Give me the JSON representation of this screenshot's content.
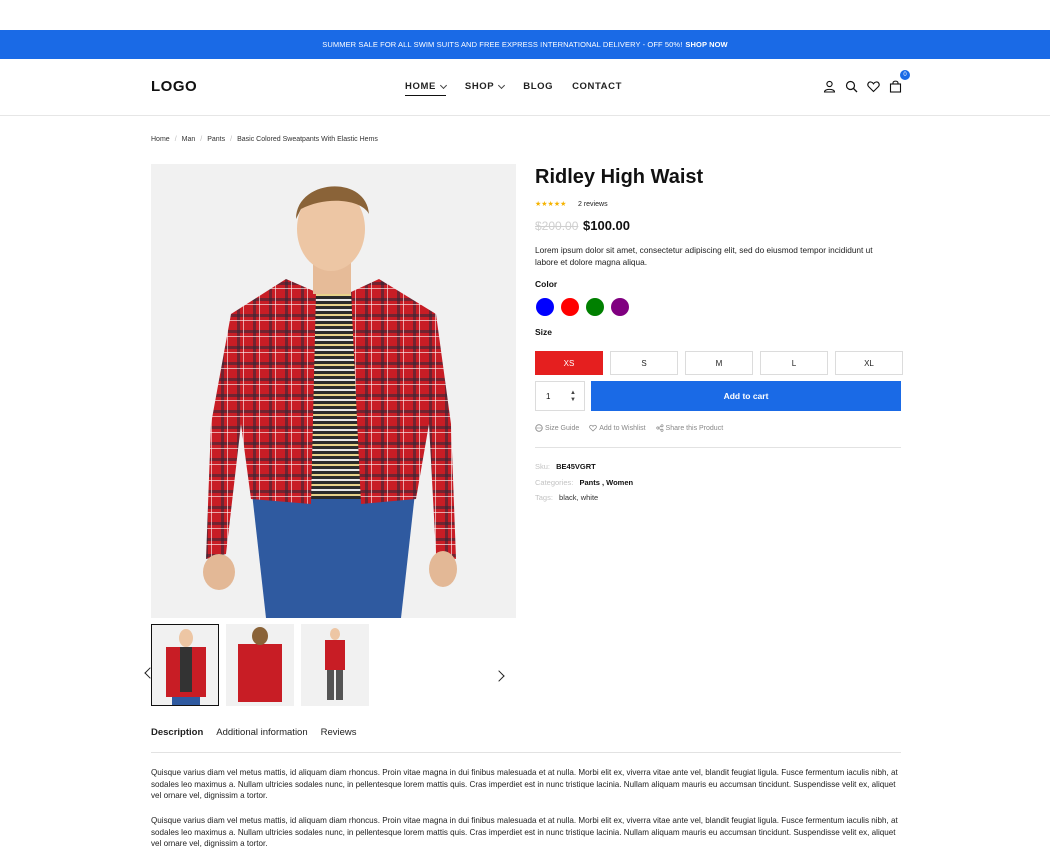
{
  "promo": {
    "text": "SUMMER SALE FOR ALL SWIM SUITS AND FREE EXPRESS INTERNATIONAL DELIVERY - OFF 50%!",
    "cta": "SHOP NOW"
  },
  "header": {
    "logo": "LOGO",
    "nav": [
      "HOME",
      "SHOP",
      "BLOG",
      "CONTACT"
    ],
    "cart_count": "0"
  },
  "breadcrumbs": [
    "Home",
    "Man",
    "Pants",
    "Basic Colored Sweatpants With Elastic Hems"
  ],
  "product": {
    "title": "Ridley High Waist",
    "reviews": "2 reviews",
    "old_price": "$200.00",
    "price": "$100.00",
    "description": "Lorem ipsum dolor sit amet, consectetur adipiscing elit, sed do eiusmod tempor incididunt ut labore et dolore magna aliqua.",
    "color_label": "Color",
    "colors": [
      "#0000ff",
      "#ff0000",
      "#008000",
      "#800080"
    ],
    "size_label": "Size",
    "sizes": [
      "XS",
      "S",
      "M",
      "L",
      "XL"
    ],
    "qty": "1",
    "add_to_cart": "Add to cart",
    "links": [
      "Size Guide",
      "Add to Wishlist",
      "Share this Product"
    ],
    "sku_label": "Sku:",
    "sku": "BE45VGRT",
    "categories_label": "Categories:",
    "categories": "Pants , Women",
    "tags_label": "Tags:",
    "tags": "black, white"
  },
  "tabs": [
    "Description",
    "Additional information",
    "Reviews"
  ],
  "description_paragraphs": [
    "Quisque varius diam vel metus mattis, id aliquam diam rhoncus. Proin vitae magna in dui finibus malesuada et at nulla. Morbi elit ex, viverra vitae ante vel, blandit feugiat ligula. Fusce fermentum iaculis nibh, at sodales leo maximus a. Nullam ultricies sodales nunc, in pellentesque lorem mattis quis. Cras imperdiet est in nunc tristique lacinia. Nullam aliquam mauris eu accumsan tincidunt. Suspendisse velit ex, aliquet vel ornare vel, dignissim a tortor.",
    "Quisque varius diam vel metus mattis, id aliquam diam rhoncus. Proin vitae magna in dui finibus malesuada et at nulla. Morbi elit ex, viverra vitae ante vel, blandit feugiat ligula. Fusce fermentum iaculis nibh, at sodales leo maximus a. Nullam ultricies sodales nunc, in pellentesque lorem mattis quis. Cras imperdiet est in nunc tristique lacinia. Nullam aliquam mauris eu accumsan tincidunt. Suspendisse velit ex, aliquet vel ornare vel, dignissim a tortor."
  ],
  "colors": {
    "accent": "#1a6ae6",
    "sale": "#e51f1f",
    "stars": "#f5b301"
  }
}
